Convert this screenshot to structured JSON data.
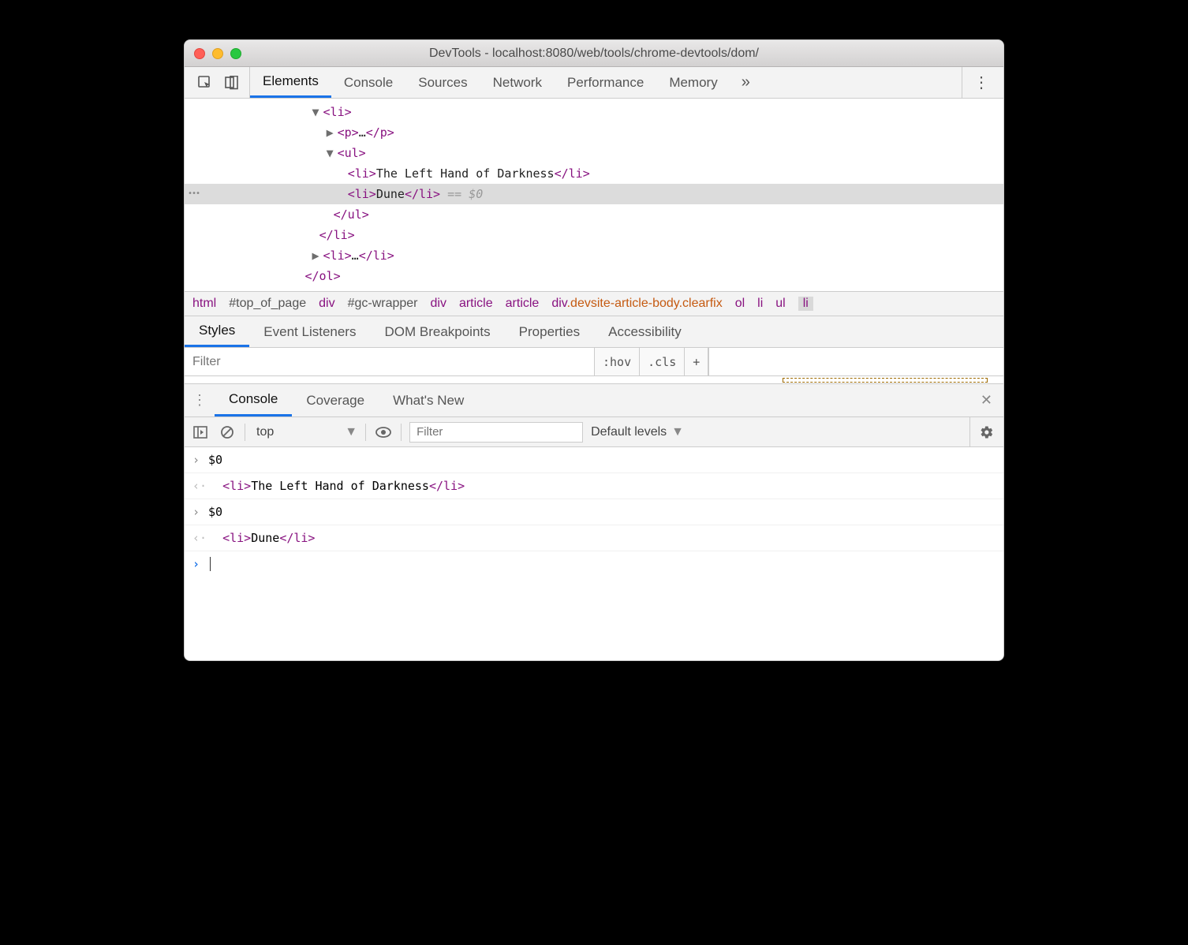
{
  "window": {
    "title": "DevTools - localhost:8080/web/tools/chrome-devtools/dom/"
  },
  "main_tabs": {
    "t0": "Elements",
    "t1": "Console",
    "t2": "Sources",
    "t3": "Network",
    "t4": "Performance",
    "t5": "Memory",
    "more": "»"
  },
  "dom": {
    "line1_tag": "<li>",
    "line2_open": "<p>",
    "line2_ellipsis": "…",
    "line2_close": "</p>",
    "line3_tag": "<ul>",
    "line4_open": "<li>",
    "line4_text": "The Left Hand of Darkness",
    "line4_close": "</li>",
    "line5_open": "<li>",
    "line5_text": "Dune",
    "line5_close": "</li>",
    "line5_ghost": " == $0",
    "line6_tag": "</ul>",
    "line7_tag": "</li>",
    "line8_open": "<li>",
    "line8_ellipsis": "…",
    "line8_close": "</li>",
    "line9_tag": "</ol>"
  },
  "breadcrumb": {
    "b0": "html",
    "b1": "#top_of_page",
    "b2": "div",
    "b3": "#gc-wrapper",
    "b4": "div",
    "b5": "article",
    "b6": "article",
    "b7a": "div",
    "b7b": ".devsite-article-body.clearfix",
    "b8": "ol",
    "b9": "li",
    "b10": "ul",
    "b11": "li"
  },
  "styles_tabs": {
    "s0": "Styles",
    "s1": "Event Listeners",
    "s2": "DOM Breakpoints",
    "s3": "Properties",
    "s4": "Accessibility"
  },
  "styles_filter": {
    "placeholder": "Filter",
    "hov": ":hov",
    "cls": ".cls",
    "plus": "+"
  },
  "drawer_tabs": {
    "d0": "Console",
    "d1": "Coverage",
    "d2": "What's New"
  },
  "console_bar": {
    "context": "top",
    "filter_placeholder": "Filter",
    "levels": "Default levels"
  },
  "console": {
    "l1": "$0",
    "l2_open": "<li>",
    "l2_text": "The Left Hand of Darkness",
    "l2_close": "</li>",
    "l3": "$0",
    "l4_open": "<li>",
    "l4_text": "Dune",
    "l4_close": "</li>"
  }
}
